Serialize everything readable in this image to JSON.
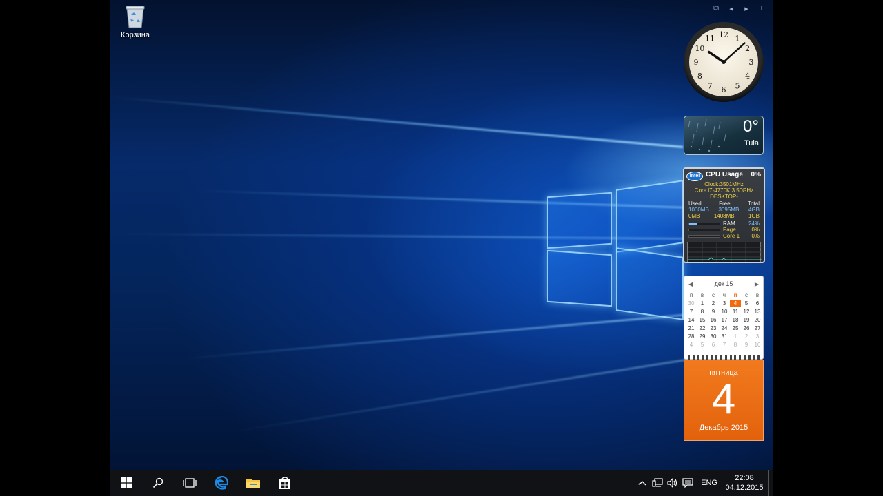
{
  "desktop": {
    "icons": [
      {
        "label": "Корзина",
        "icon": "recycle-bin-icon"
      }
    ]
  },
  "gadgets": {
    "clock": {
      "hour": 10,
      "minute": 8,
      "numbers": [
        "12",
        "1",
        "2",
        "3",
        "4",
        "5",
        "6",
        "7",
        "8",
        "9",
        "10",
        "11"
      ]
    },
    "weather": {
      "temperature": "0°",
      "city": "Tula"
    },
    "cpu": {
      "logo": "intel",
      "title": "CPU Usage",
      "usage": "0%",
      "clock": "Clock:3501MHz",
      "model": "Core i7-4770K 3.50GHz",
      "host": "DESKTOP-",
      "mem_headers": [
        "Used",
        "Free",
        "Total"
      ],
      "mem_rows": [
        [
          "1000MB",
          "3095MB",
          "4GB"
        ],
        [
          "0MB",
          "1408MB",
          "1GB"
        ]
      ],
      "meters": [
        {
          "label": "RAM",
          "value": "24%",
          "fill": 0.24
        },
        {
          "label": "Page",
          "value": "0%",
          "fill": 0.0
        },
        {
          "label": "Core 1",
          "value": "0%",
          "fill": 0.0
        }
      ]
    },
    "calendar": {
      "month_label": "дек 15",
      "weekdays": [
        "п",
        "в",
        "с",
        "ч",
        "п",
        "с",
        "в"
      ],
      "weeks": [
        [
          "30",
          "1",
          "2",
          "3",
          "4",
          "5",
          "6"
        ],
        [
          "7",
          "8",
          "9",
          "10",
          "11",
          "12",
          "13"
        ],
        [
          "14",
          "15",
          "16",
          "17",
          "18",
          "19",
          "20"
        ],
        [
          "21",
          "22",
          "23",
          "24",
          "25",
          "26",
          "27"
        ],
        [
          "28",
          "29",
          "30",
          "31",
          "1",
          "2",
          "3"
        ],
        [
          "4",
          "5",
          "6",
          "7",
          "8",
          "9",
          "10"
        ]
      ],
      "today": "4",
      "weekday_name": "пятница",
      "day_number": "4",
      "month_year": "Декабрь 2015"
    }
  },
  "taskbar": {
    "buttons": [
      {
        "name": "start-button",
        "icon": "windows-logo-icon"
      },
      {
        "name": "search-button",
        "icon": "search-icon"
      },
      {
        "name": "task-view-button",
        "icon": "task-view-icon"
      },
      {
        "name": "edge-button",
        "icon": "edge-icon"
      },
      {
        "name": "file-explorer-button",
        "icon": "folder-icon"
      },
      {
        "name": "store-button",
        "icon": "store-icon"
      }
    ],
    "tray": {
      "language": "ENG",
      "time": "22:08",
      "date": "04.12.2015"
    }
  },
  "colors": {
    "accent": "#e8670f",
    "taskbar": "#101215",
    "edge_blue": "#1e88e5",
    "folder_yellow": "#f5c542"
  }
}
